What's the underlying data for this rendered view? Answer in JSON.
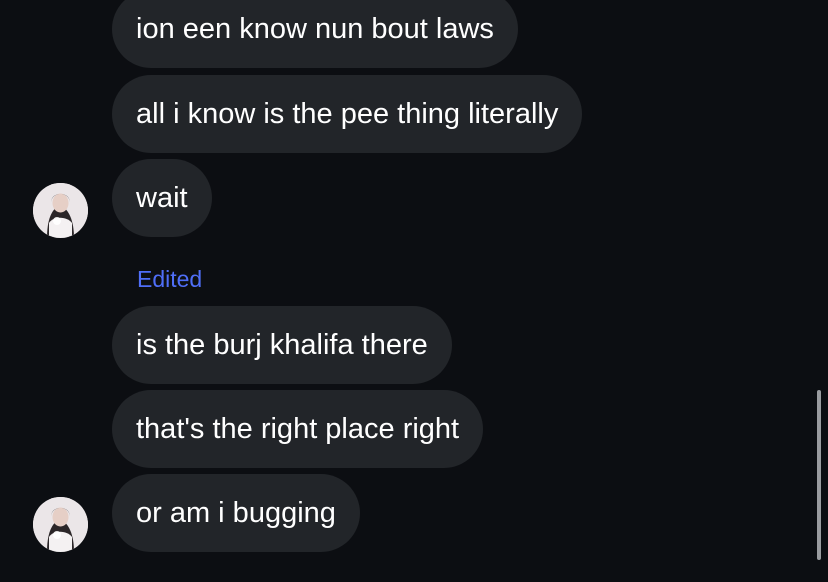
{
  "messages": [
    {
      "text": "ion een know nun bout laws"
    },
    {
      "text": "all i know is the pee thing literally"
    },
    {
      "text": "wait"
    },
    {
      "text": "is the burj khalifa there"
    },
    {
      "text": "that's the right place right"
    },
    {
      "text": "or am i bugging"
    }
  ],
  "edited_label": "Edited",
  "colors": {
    "background": "#0c0e12",
    "bubble": "#222529",
    "text": "#ffffff",
    "edited": "#4f6ef7"
  },
  "icons": {
    "avatar": "user-avatar-photo"
  }
}
